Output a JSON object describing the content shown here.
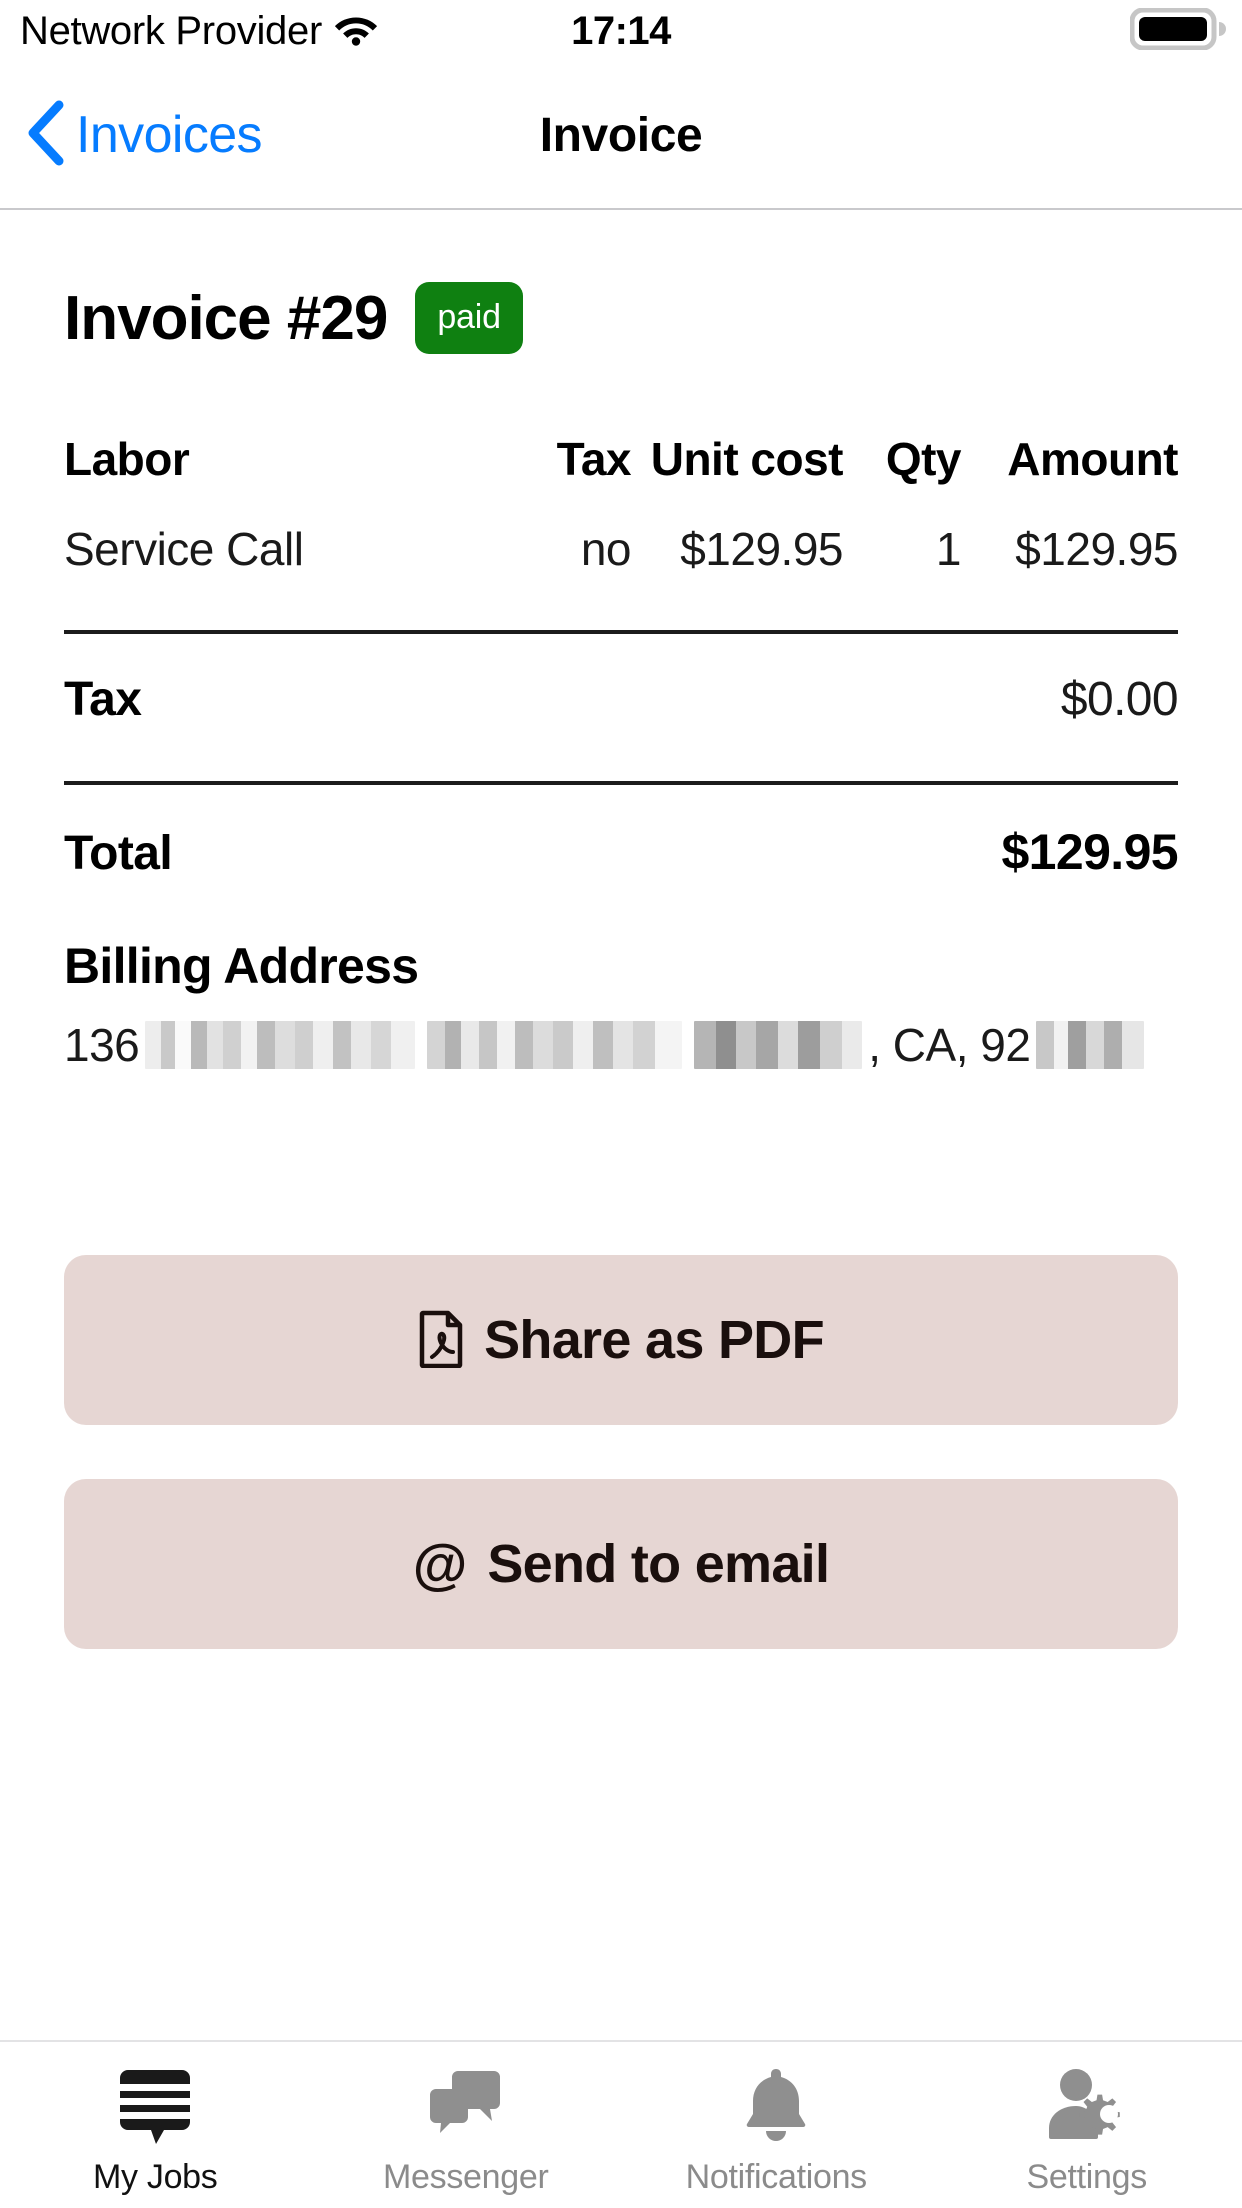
{
  "status_bar": {
    "carrier": "Network Provider",
    "wifi_icon": "wifi-icon",
    "time": "17:14",
    "battery_icon": "battery-full-icon"
  },
  "nav_bar": {
    "back_icon": "chevron-left-icon",
    "back_label": "Invoices",
    "title": "Invoice"
  },
  "invoice": {
    "title": "Invoice #29",
    "status_badge": "paid",
    "badge_color": "#0f8011",
    "table": {
      "headers": [
        "Labor",
        "Tax",
        "Unit cost",
        "Qty",
        "Amount"
      ],
      "rows": [
        {
          "labor": "Service Call",
          "tax": "no",
          "unit_cost": "$129.95",
          "qty": "1",
          "amount": "$129.95"
        }
      ]
    },
    "summary": [
      {
        "label": "Tax",
        "value": "$0.00"
      },
      {
        "label": "Total",
        "value": "$129.95"
      }
    ],
    "billing": {
      "heading": "Billing Address",
      "street_number": "136",
      "state_zip_prefix": ", CA, 92",
      "redacted": true
    }
  },
  "actions": {
    "share_pdf": {
      "label": "Share as PDF",
      "icon": "pdf-file-icon"
    },
    "send_email": {
      "label": "Send to email",
      "icon": "at-sign-icon"
    },
    "background_color": "#e6d6d3"
  },
  "tab_bar": {
    "items": [
      {
        "label": "My Jobs",
        "icon": "jobs-list-bubble-icon",
        "active": true
      },
      {
        "label": "Messenger",
        "icon": "chat-bubbles-icon",
        "active": false
      },
      {
        "label": "Notifications",
        "icon": "bell-icon",
        "active": false
      },
      {
        "label": "Settings",
        "icon": "user-gear-icon",
        "active": false
      }
    ]
  }
}
